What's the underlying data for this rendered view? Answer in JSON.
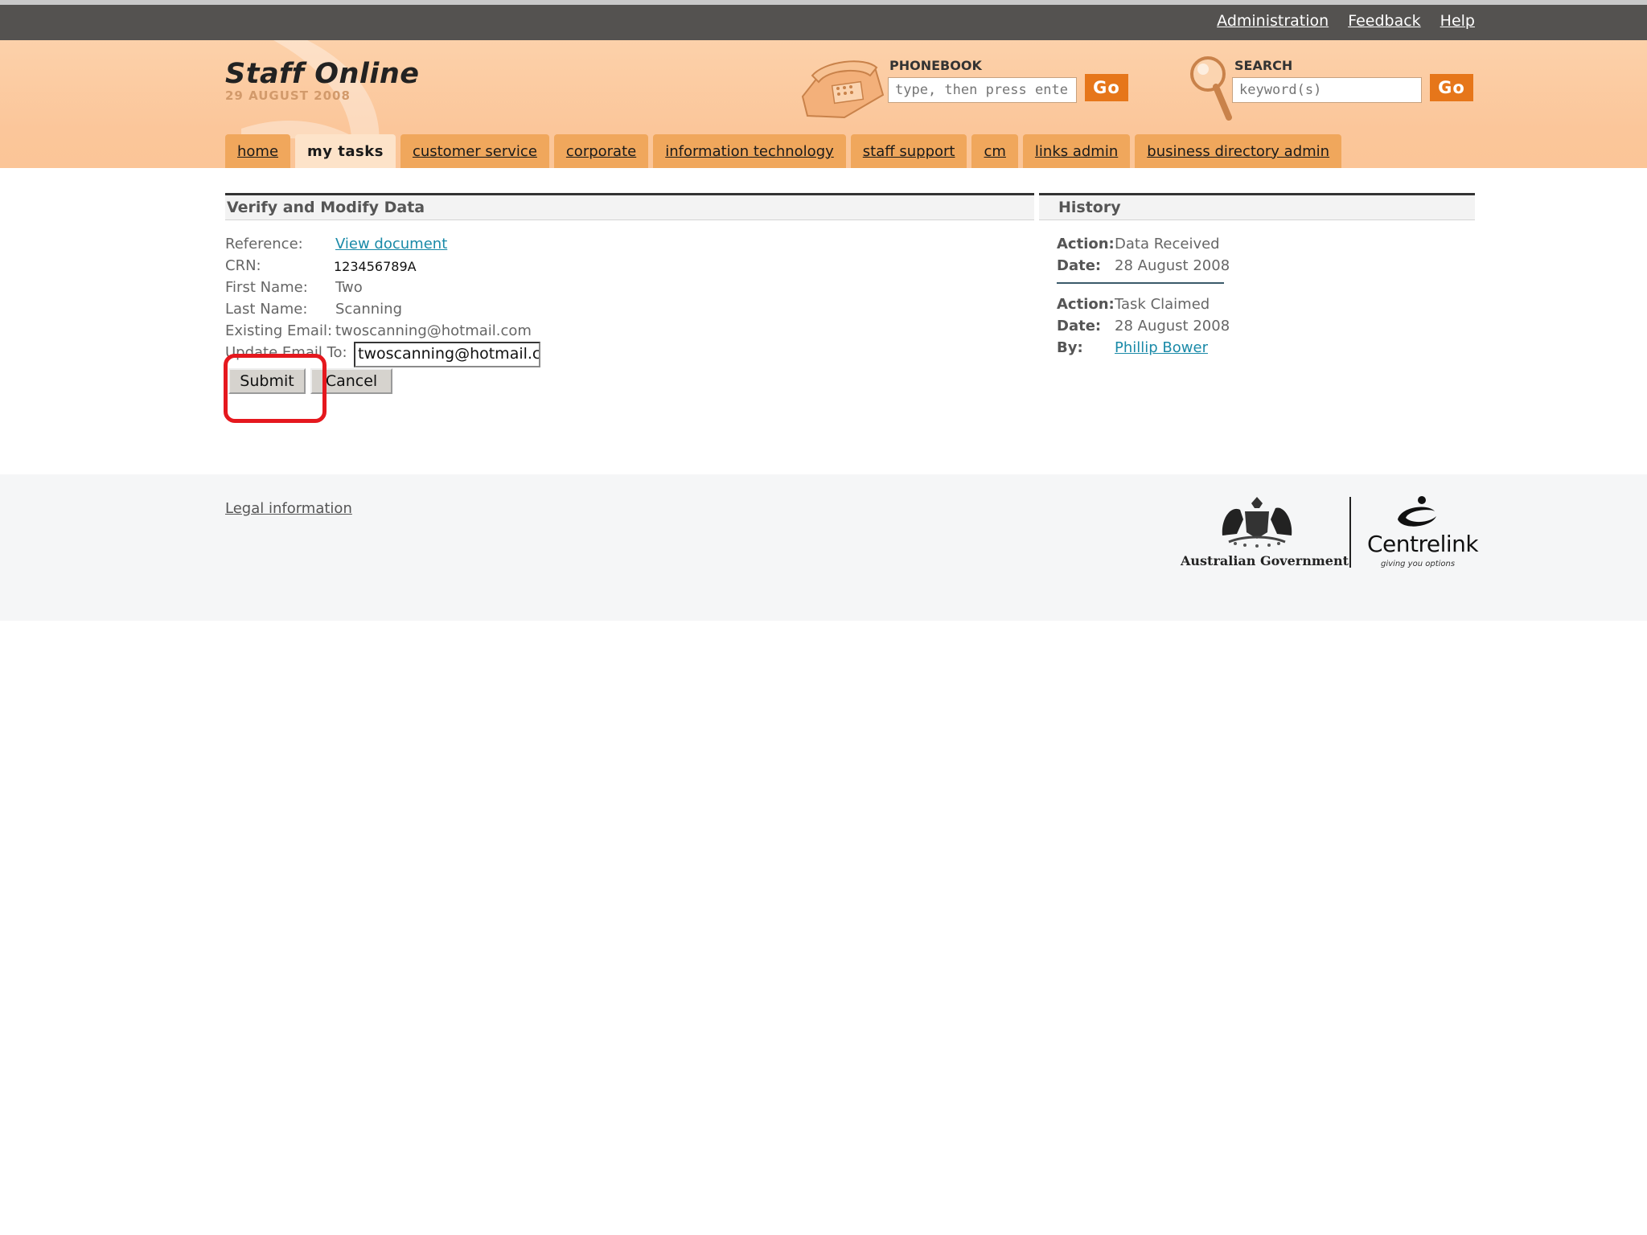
{
  "topbar": {
    "links": [
      "Administration",
      "Feedback",
      "Help"
    ]
  },
  "header": {
    "site_title": "Staff Online",
    "date": "29 AUGUST 2008",
    "phonebook": {
      "label": "PHONEBOOK",
      "placeholder": "type, then press enter",
      "go_label": "Go"
    },
    "search": {
      "label": "SEARCH",
      "placeholder": "keyword(s)",
      "go_label": "Go"
    }
  },
  "nav": {
    "tabs": [
      "home",
      "my tasks",
      "customer service",
      "corporate",
      "information technology",
      "staff support",
      "cm",
      "links admin",
      "business directory admin"
    ],
    "active": "my tasks"
  },
  "form": {
    "title": "Verify and Modify Data",
    "reference_label": "Reference:",
    "reference_link": "View document",
    "crn_label": "CRN:",
    "crn_value": "123456789A",
    "first_name_label": "First Name:",
    "first_name_value": "Two",
    "last_name_label": "Last Name:",
    "last_name_value": "Scanning",
    "existing_email_label": "Existing Email:",
    "existing_email_value": "twoscanning@hotmail.com",
    "update_email_label": "Update Email To:",
    "update_email_value": "twoscanning@hotmail.c",
    "submit_label": "Submit",
    "cancel_label": "Cancel"
  },
  "history": {
    "title": "History",
    "entries": [
      {
        "action_label": "Action:",
        "action": "Data Received",
        "date_label": "Date:",
        "date": "28 August 2008"
      },
      {
        "action_label": "Action:",
        "action": "Task Claimed",
        "date_label": "Date:",
        "date": "28 August 2008",
        "by_label": "By:",
        "by": "Phillip Bower"
      }
    ]
  },
  "footer": {
    "legal_link": "Legal information",
    "gov_name": "Australian Government",
    "brand_name": "Centrelink",
    "brand_tagline": "giving you options"
  },
  "colors": {
    "topbar": "#545250",
    "header_peach": "#fbc69a",
    "tab_orange": "#f0a75c",
    "go_button": "#e6761a",
    "link_teal": "#1a8aa8",
    "highlight_red": "#e5181e"
  }
}
